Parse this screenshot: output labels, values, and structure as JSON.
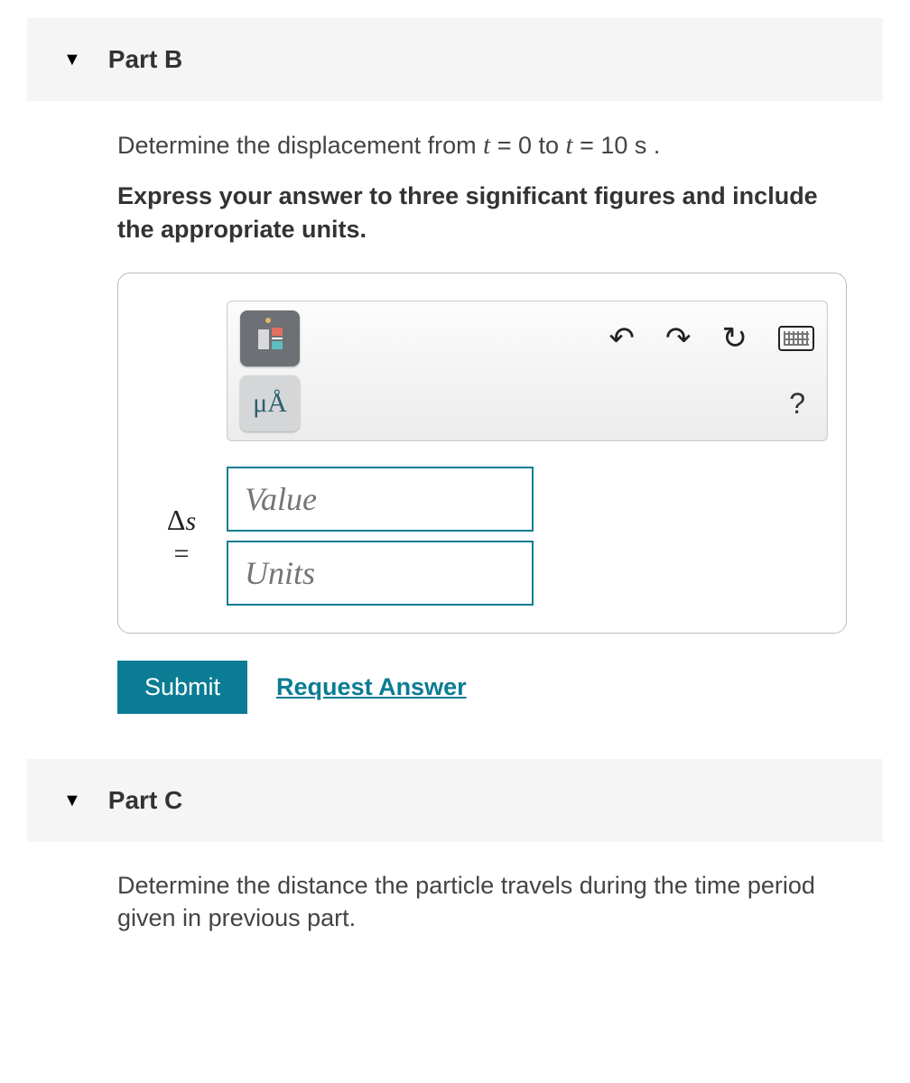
{
  "partB": {
    "title": "Part B",
    "prompt_pre": "Determine the displacement from ",
    "prompt_var1": "t",
    "prompt_mid1": " = 0 to ",
    "prompt_var2": "t",
    "prompt_mid2": " = 10  s .",
    "instruction": "Express your answer to three significant figures and include the appropriate units.",
    "toolbar": {
      "unit_btn": "μÅ",
      "help": "?"
    },
    "answer": {
      "symbol_delta": "Δ",
      "symbol_var": "s",
      "symbol_eq": "=",
      "value_placeholder": "Value",
      "units_placeholder": "Units"
    },
    "submit": "Submit",
    "request": "Request Answer"
  },
  "partC": {
    "title": "Part C",
    "prompt": "Determine the distance the particle travels during the time period given in previous part."
  }
}
